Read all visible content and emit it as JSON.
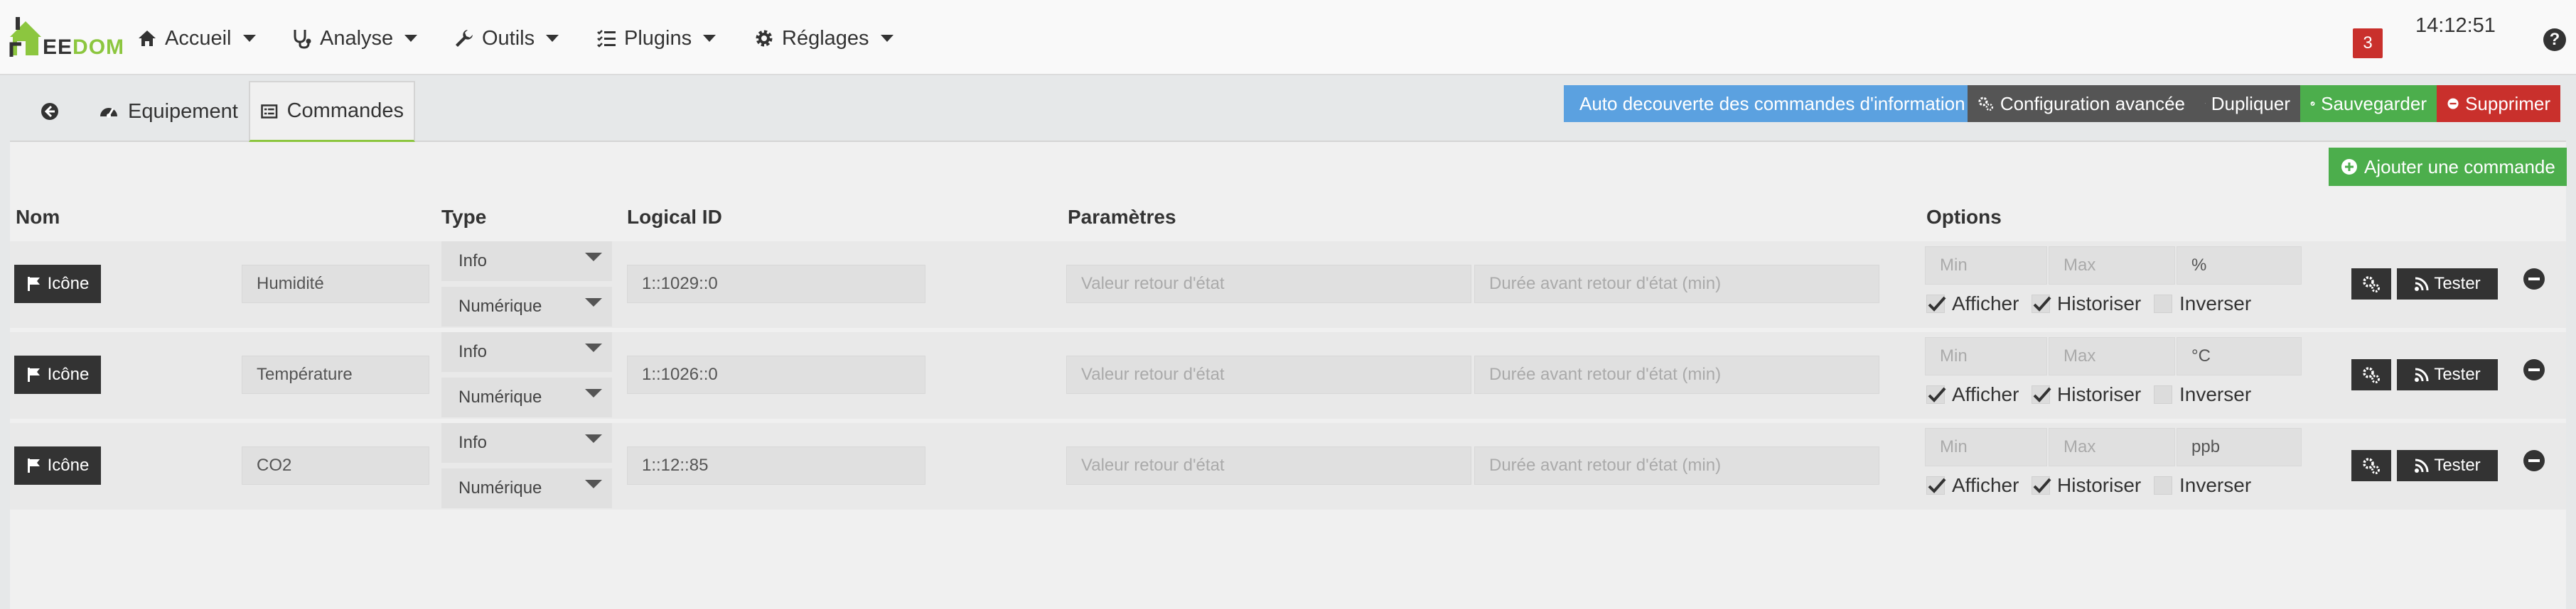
{
  "brand": {
    "logo_text_a": "EE",
    "logo_text_b": "DOM"
  },
  "nav": {
    "items": [
      {
        "label": "Accueil",
        "icon": "home-icon"
      },
      {
        "label": "Analyse",
        "icon": "stethoscope-icon"
      },
      {
        "label": "Outils",
        "icon": "wrench-icon"
      },
      {
        "label": "Plugins",
        "icon": "tasks-icon"
      },
      {
        "label": "Réglages",
        "icon": "gear-icon"
      }
    ],
    "badge_count": "3",
    "clock": "14:12:51",
    "help": "?"
  },
  "tabs": [
    {
      "label": "",
      "icon": "back-circle-icon"
    },
    {
      "label": "Equipement",
      "icon": "tachometer-icon"
    },
    {
      "label": "Commandes",
      "icon": "list-alt-icon"
    }
  ],
  "actions": {
    "auto_discovery": "Auto decouverte des commandes d'information",
    "advanced_config": "Configuration avancée",
    "duplicate": "Dupliquer",
    "save": "Sauvegarder",
    "delete": "Supprimer",
    "add_command": "Ajouter une commande"
  },
  "table": {
    "headers": {
      "name": "Nom",
      "type": "Type",
      "logical_id": "Logical ID",
      "params": "Paramètres",
      "options": "Options"
    },
    "icon_button": "Icône",
    "placeholders": {
      "state_return": "Valeur retour d'état",
      "state_delay": "Durée avant retour d'état (min)",
      "min": "Min",
      "max": "Max"
    },
    "labels": {
      "show": "Afficher",
      "historize": "Historiser",
      "invert": "Inverser",
      "test": "Tester"
    },
    "rows": [
      {
        "name": "Humidité",
        "type": "Info",
        "subtype": "Numérique",
        "logical_id": "1::1029::0",
        "unit": "%",
        "show": true,
        "historize": true,
        "invert": false
      },
      {
        "name": "Température",
        "type": "Info",
        "subtype": "Numérique",
        "logical_id": "1::1026::0",
        "unit": "°C",
        "show": true,
        "historize": true,
        "invert": false
      },
      {
        "name": "CO2",
        "type": "Info",
        "subtype": "Numérique",
        "logical_id": "1::12::85",
        "unit": "ppb",
        "show": true,
        "historize": true,
        "invert": false
      }
    ]
  },
  "colors": {
    "primary": "#5ba1e0",
    "success": "#4cae4c",
    "danger": "#c9302c",
    "dark": "#333333",
    "brand_green": "#8cc63f"
  }
}
